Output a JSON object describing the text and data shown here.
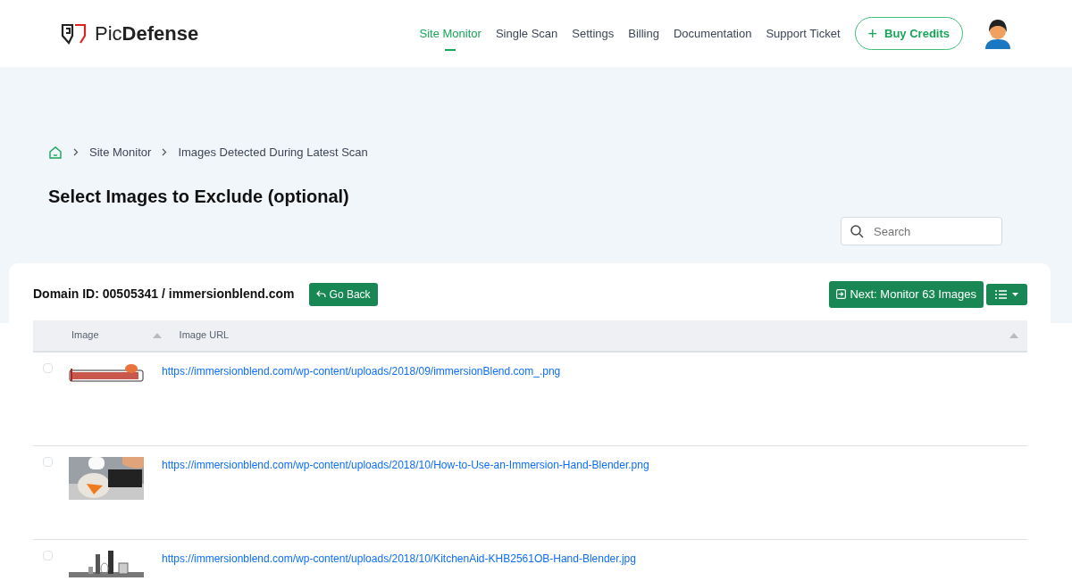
{
  "brand": {
    "name": "Pic**Defense**"
  },
  "nav": [
    {
      "label": "Site Monitor",
      "selected": true
    },
    {
      "label": "Single Scan",
      "selected": false
    },
    {
      "label": "Settings",
      "selected": false
    },
    {
      "label": "Billing",
      "selected": false
    },
    {
      "label": "Documentation",
      "selected": false
    },
    {
      "label": "Support Ticket",
      "selected": false
    }
  ],
  "buy_button": {
    "icon": "+",
    "label": "Buy Credits"
  },
  "breadcrumb": [
    "Site Monitor",
    "Images Detected During Latest Scan"
  ],
  "page_title": "Select Images to Exclude (optional)",
  "search": {
    "placeholder": "Search"
  },
  "card": {
    "domain": "Domain ID: 00505341 / immersionblend.com",
    "back_button": "Go Back",
    "next_button": "Next: Monitor 63 Images"
  },
  "table": {
    "columns": [
      "Image",
      "Image URL"
    ],
    "rows": [
      {
        "checked": false,
        "kind": "picture",
        "url": "https://immersionblend.com/wp-content/uploads/2018/09/immersionBlend.com_.png"
      },
      {
        "checked": false,
        "kind": "picture",
        "url": "https://immersionblend.com/wp-content/uploads/2018/10/How-to-Use-an-Immersion-Hand-Blender.png"
      },
      {
        "checked": false,
        "kind": "picture",
        "url": "https://immersionblend.com/wp-content/uploads/2018/10/KitchenAid-KHB2561OB-Hand-Blender.jpg"
      }
    ]
  }
}
